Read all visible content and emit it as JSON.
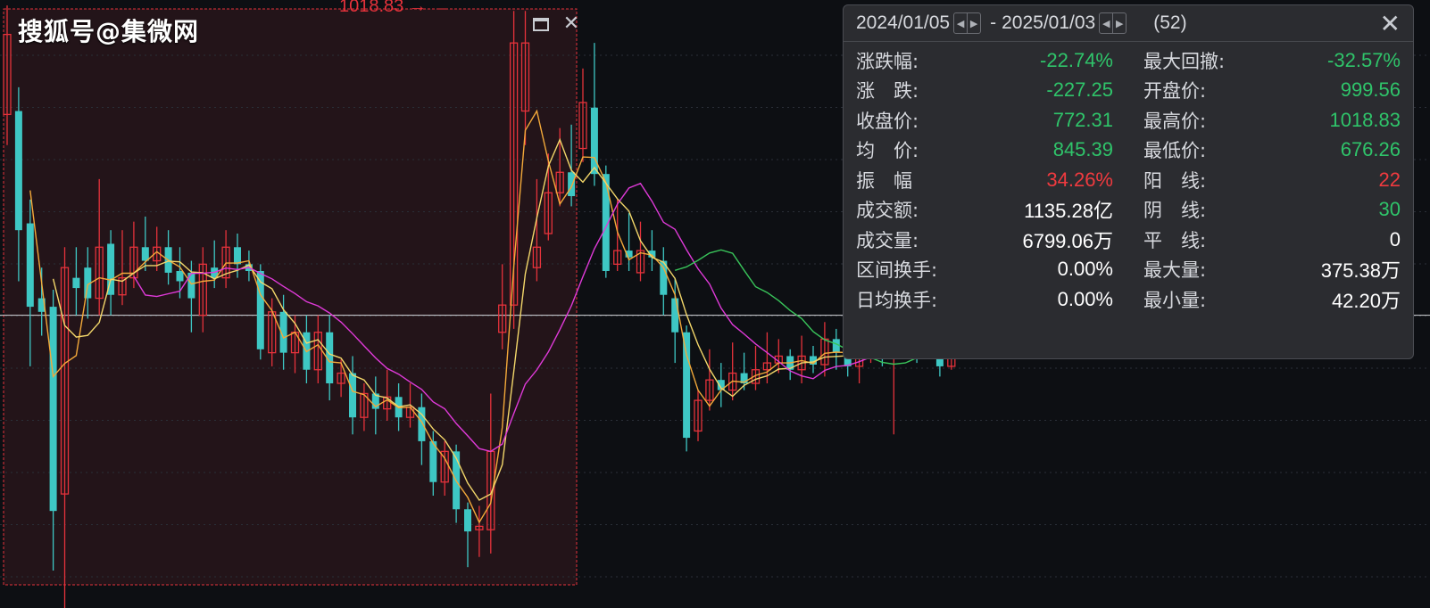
{
  "watermark": "搜狐号@集微网",
  "high_marker": "1018.83 →",
  "selection_tools": {
    "maximize_icon": "maximize-icon",
    "close_icon": "close-icon",
    "close_glyph": "✕"
  },
  "panel": {
    "date_start": "2024/01/05",
    "date_end": "2025/01/03",
    "separator": "-",
    "bar_count": "(52)",
    "close_glyph": "✕",
    "prev_glyph": "◀",
    "next_glyph": "▶",
    "left": [
      {
        "label": "涨跌幅:",
        "value": "-22.74%",
        "color": "g"
      },
      {
        "label": "涨　跌:",
        "value": "-227.25",
        "color": "g"
      },
      {
        "label": "收盘价:",
        "value": "772.31",
        "color": "g"
      },
      {
        "label": "均　价:",
        "value": "845.39",
        "color": "g"
      },
      {
        "label": "振　幅",
        "value": "34.26%",
        "color": "r"
      },
      {
        "label": "成交额:",
        "value": "1135.28亿",
        "color": "w"
      },
      {
        "label": "成交量:",
        "value": "6799.06万",
        "color": "w"
      },
      {
        "label": "区间换手:",
        "value": "0.00%",
        "color": "w"
      },
      {
        "label": "日均换手:",
        "value": "0.00%",
        "color": "w"
      }
    ],
    "right": [
      {
        "label": "最大回撤:",
        "value": "-32.57%",
        "color": "g"
      },
      {
        "label": "开盘价:",
        "value": "999.56",
        "color": "g"
      },
      {
        "label": "最高价:",
        "value": "1018.83",
        "color": "g"
      },
      {
        "label": "最低价:",
        "value": "676.26",
        "color": "g"
      },
      {
        "label": "阳　线:",
        "value": "22",
        "color": "r"
      },
      {
        "label": "阴　线:",
        "value": "30",
        "color": "g"
      },
      {
        "label": "平　线:",
        "value": "0",
        "color": "w"
      },
      {
        "label": "最大量:",
        "value": "375.38万",
        "color": "w"
      },
      {
        "label": "最小量:",
        "value": "42.20万",
        "color": "w"
      }
    ]
  },
  "colors": {
    "up": "#e5323b",
    "down": "#3ec7c4",
    "ma_yellow": "#f3d76a",
    "ma_orange": "#f3a93a",
    "ma_magenta": "#e03ad9",
    "ma_green": "#39c45a",
    "selection_bg": "#231419"
  },
  "chart_data": {
    "type": "candlestick",
    "candles": [
      {
        "o": 958,
        "c": 1005,
        "h": 1022,
        "l": 940
      },
      {
        "o": 960,
        "c": 890,
        "h": 974,
        "l": 860
      },
      {
        "o": 894,
        "c": 845,
        "h": 908,
        "l": 810
      },
      {
        "o": 850,
        "c": 842,
        "h": 868,
        "l": 828
      },
      {
        "o": 845,
        "c": 725,
        "h": 855,
        "l": 690
      },
      {
        "o": 735,
        "c": 868,
        "h": 880,
        "l": 648
      },
      {
        "o": 862,
        "c": 856,
        "h": 880,
        "l": 840
      },
      {
        "o": 868,
        "c": 850,
        "h": 880,
        "l": 838
      },
      {
        "o": 850,
        "c": 880,
        "h": 920,
        "l": 840
      },
      {
        "o": 882,
        "c": 852,
        "h": 890,
        "l": 840
      },
      {
        "o": 852,
        "c": 862,
        "h": 890,
        "l": 846
      },
      {
        "o": 862,
        "c": 880,
        "h": 895,
        "l": 856
      },
      {
        "o": 880,
        "c": 872,
        "h": 898,
        "l": 866
      },
      {
        "o": 872,
        "c": 880,
        "h": 892,
        "l": 866
      },
      {
        "o": 880,
        "c": 865,
        "h": 890,
        "l": 858
      },
      {
        "o": 866,
        "c": 860,
        "h": 880,
        "l": 850
      },
      {
        "o": 865,
        "c": 850,
        "h": 872,
        "l": 830
      },
      {
        "o": 840,
        "c": 870,
        "h": 880,
        "l": 830
      },
      {
        "o": 868,
        "c": 862,
        "h": 884,
        "l": 856
      },
      {
        "o": 862,
        "c": 880,
        "h": 890,
        "l": 856
      },
      {
        "o": 880,
        "c": 870,
        "h": 888,
        "l": 862
      },
      {
        "o": 870,
        "c": 866,
        "h": 878,
        "l": 860
      },
      {
        "o": 866,
        "c": 820,
        "h": 870,
        "l": 814
      },
      {
        "o": 818,
        "c": 842,
        "h": 850,
        "l": 810
      },
      {
        "o": 842,
        "c": 818,
        "h": 852,
        "l": 808
      },
      {
        "o": 818,
        "c": 830,
        "h": 840,
        "l": 806
      },
      {
        "o": 830,
        "c": 808,
        "h": 840,
        "l": 800
      },
      {
        "o": 808,
        "c": 830,
        "h": 840,
        "l": 800
      },
      {
        "o": 830,
        "c": 800,
        "h": 840,
        "l": 790
      },
      {
        "o": 800,
        "c": 806,
        "h": 814,
        "l": 792
      },
      {
        "o": 806,
        "c": 780,
        "h": 816,
        "l": 770
      },
      {
        "o": 780,
        "c": 794,
        "h": 800,
        "l": 772
      },
      {
        "o": 794,
        "c": 785,
        "h": 804,
        "l": 770
      },
      {
        "o": 785,
        "c": 792,
        "h": 808,
        "l": 778
      },
      {
        "o": 792,
        "c": 780,
        "h": 800,
        "l": 772
      },
      {
        "o": 780,
        "c": 786,
        "h": 800,
        "l": 774
      },
      {
        "o": 786,
        "c": 766,
        "h": 794,
        "l": 752
      },
      {
        "o": 766,
        "c": 742,
        "h": 772,
        "l": 734
      },
      {
        "o": 742,
        "c": 760,
        "h": 766,
        "l": 734
      },
      {
        "o": 760,
        "c": 726,
        "h": 764,
        "l": 718
      },
      {
        "o": 726,
        "c": 713,
        "h": 730,
        "l": 692
      },
      {
        "o": 714,
        "c": 716,
        "h": 728,
        "l": 698
      },
      {
        "o": 714,
        "c": 760,
        "h": 794,
        "l": 700
      },
      {
        "o": 830,
        "c": 846,
        "h": 870,
        "l": 820
      },
      {
        "o": 846,
        "c": 1000,
        "h": 1018.83,
        "l": 832
      },
      {
        "o": 960,
        "c": 1000,
        "h": 1018.83,
        "l": 940
      },
      {
        "o": 868,
        "c": 880,
        "h": 920,
        "l": 860
      },
      {
        "o": 888,
        "c": 912,
        "h": 935,
        "l": 884
      },
      {
        "o": 912,
        "c": 924,
        "h": 950,
        "l": 904
      },
      {
        "o": 924,
        "c": 910,
        "h": 952,
        "l": 904
      },
      {
        "o": 938,
        "c": 965,
        "h": 985,
        "l": 930
      },
      {
        "o": 962,
        "c": 923,
        "h": 1000,
        "l": 916
      },
      {
        "o": 923,
        "c": 866,
        "h": 928,
        "l": 862
      },
      {
        "o": 870,
        "c": 878,
        "h": 908,
        "l": 866
      },
      {
        "o": 878,
        "c": 874,
        "h": 900,
        "l": 866
      },
      {
        "o": 865,
        "c": 878,
        "h": 895,
        "l": 860
      },
      {
        "o": 878,
        "c": 874,
        "h": 890,
        "l": 866
      },
      {
        "o": 872,
        "c": 852,
        "h": 880,
        "l": 840
      },
      {
        "o": 850,
        "c": 830,
        "h": 862,
        "l": 812
      },
      {
        "o": 830,
        "c": 768,
        "h": 834,
        "l": 760
      },
      {
        "o": 772,
        "c": 790,
        "h": 796,
        "l": 766
      },
      {
        "o": 790,
        "c": 802,
        "h": 820,
        "l": 784
      },
      {
        "o": 802,
        "c": 796,
        "h": 812,
        "l": 786
      },
      {
        "o": 796,
        "c": 806,
        "h": 824,
        "l": 790
      },
      {
        "o": 806,
        "c": 800,
        "h": 818,
        "l": 796
      },
      {
        "o": 800,
        "c": 808,
        "h": 822,
        "l": 796
      },
      {
        "o": 808,
        "c": 812,
        "h": 830,
        "l": 800
      },
      {
        "o": 812,
        "c": 816,
        "h": 826,
        "l": 806
      },
      {
        "o": 816,
        "c": 808,
        "h": 820,
        "l": 802
      },
      {
        "o": 808,
        "c": 816,
        "h": 828,
        "l": 800
      },
      {
        "o": 816,
        "c": 811,
        "h": 822,
        "l": 806
      },
      {
        "o": 811,
        "c": 826,
        "h": 836,
        "l": 804
      },
      {
        "o": 826,
        "c": 818,
        "h": 832,
        "l": 808
      },
      {
        "o": 818,
        "c": 810,
        "h": 828,
        "l": 804
      },
      {
        "o": 810,
        "c": 822,
        "h": 836,
        "l": 800
      },
      {
        "o": 822,
        "c": 838,
        "h": 848,
        "l": 812
      },
      {
        "o": 838,
        "c": 818,
        "h": 844,
        "l": 810
      },
      {
        "o": 820,
        "c": 830,
        "h": 840,
        "l": 770
      },
      {
        "o": 830,
        "c": 845,
        "h": 852,
        "l": 820
      },
      {
        "o": 845,
        "c": 828,
        "h": 852,
        "l": 812
      },
      {
        "o": 828,
        "c": 840,
        "h": 848,
        "l": 818
      },
      {
        "o": 840,
        "c": 810,
        "h": 846,
        "l": 804
      },
      {
        "o": 810,
        "c": 830,
        "h": 840,
        "l": 808
      },
      {
        "o": 830,
        "c": 840,
        "h": 848,
        "l": 826
      },
      {
        "o": 840,
        "c": 826,
        "h": 846,
        "l": 820
      },
      {
        "o": 826,
        "c": 836,
        "h": 842,
        "l": 820
      },
      {
        "o": 836,
        "c": 824,
        "h": 840,
        "l": 818
      },
      {
        "o": 824,
        "c": 834,
        "h": 840,
        "l": 820
      }
    ],
    "reference_line": 840,
    "selection_high": 1018.83
  }
}
